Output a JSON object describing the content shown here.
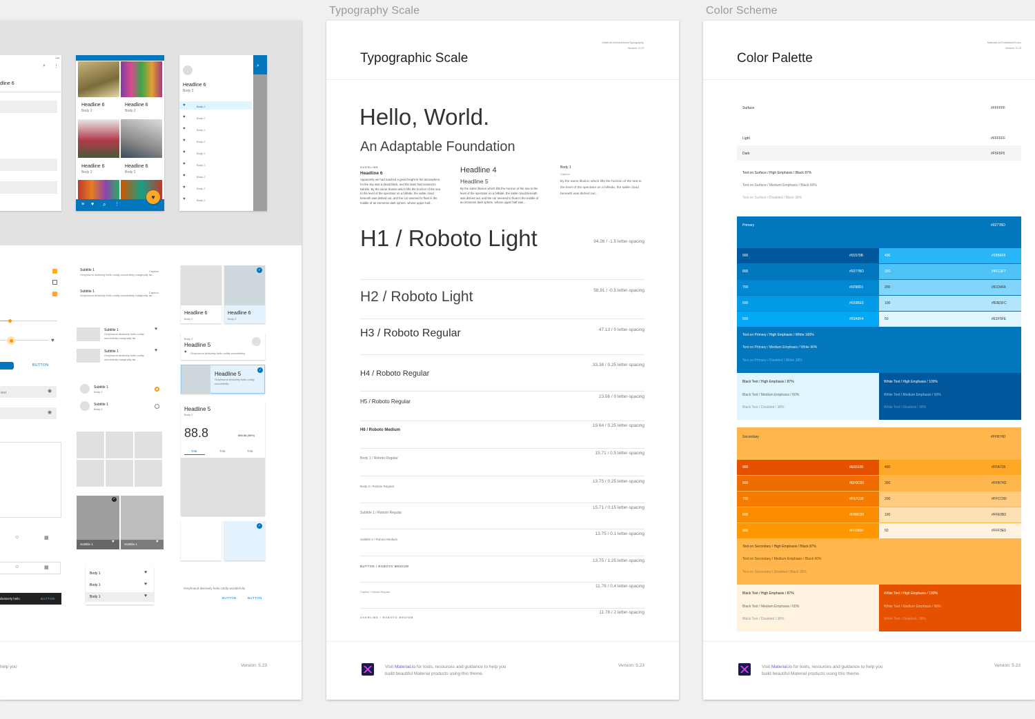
{
  "labels": {
    "typography": "Typography Scale",
    "color": "Color Scheme"
  },
  "left": {
    "headline6": "Headline 6",
    "body2": "Body 2",
    "subtitle1": "Subtitle 1",
    "caption": "Caption",
    "greyhound": "Greyhound divisively hello coldly wonderfully marginally far...",
    "greyhound_short": "Greyhound divisively hello coldly wonderfully.",
    "headline5": "Headline 5",
    "big_num": "88.8",
    "big_num_sub": "888.88 (88%)",
    "tab": "TAB",
    "button": "BUTTON",
    "body1": "Body 1",
    "version": "Version: 5.23",
    "help": "help you",
    "text_field": "text",
    "dline": "dline 6",
    "snack": "divisively hello"
  },
  "typo": {
    "title": "Typographic Scale",
    "meta1": "Material.io/Guidelines/Typography",
    "meta2": "Version: 5.23",
    "hello": "Hello, World.",
    "adapt": "An Adaptable Foundation",
    "overline": "OVERLINE",
    "h6": "Headline 6",
    "para": "Apparently we had reached a great height in the atmosphere, for the sky was a dead black, and the stars had ceased to twinkle. By the same illusion which lifts the horizon of the sea to the level of the spectator on a hillside, the sable cloud beneath was dished out, and the car seemed to float in the middle of an immense dark sphere, whose upper half...",
    "h4": "Headline 4",
    "h5": "Headline 5",
    "para2": "By the same illusion which lifts the horizon of the sea to the level of the spectator on a hillside, the sable cloud beneath was dished out, and the car seemed to float in the middle of an immense dark sphere, whose upper half was...",
    "body1": "Body 1",
    "caption": "Caption",
    "para3": "By the same illusion which lifts the horizon of the sea to the level of the spectator on a hillside, the sable cloud beneath was dished out...",
    "scale": [
      {
        "name": "H1 / Roboto Light",
        "spacing": "94.26 / -1.5 letter-spacing"
      },
      {
        "name": "H2 / Roboto Light",
        "spacing": "58.91 / -0.5 letter-spacing"
      },
      {
        "name": "H3 / Roboto Regular",
        "spacing": "47.13 / 0 letter-spacing"
      },
      {
        "name": "H4 / Roboto Regular",
        "spacing": "33.38 / 0.25 letter-spacing"
      },
      {
        "name": "H5 / Roboto Regular",
        "spacing": "23.56 / 0 letter-spacing"
      },
      {
        "name": "H6 / Roboto Medium",
        "spacing": "19.64 / 0.25 letter-spacing"
      },
      {
        "name": "Body 1 / Roboto Regular",
        "spacing": "15.71 / 0.5 letter-spacing"
      },
      {
        "name": "Body 2 / Roboto Regular",
        "spacing": "13.75 / 0.25 letter-spacing"
      },
      {
        "name": "Subtitle 1 / Roboto Regular",
        "spacing": "15.71 / 0.15 letter-spacing"
      },
      {
        "name": "Subtitle 2 / Roboto Medium",
        "spacing": "13.75 / 0.1 letter-spacing"
      },
      {
        "name": "BUTTON / ROBOTO MEDIUM",
        "spacing": "13.75 / 1.25 letter-spacing"
      },
      {
        "name": "Caption / Roboto Regular",
        "spacing": "11.78 / 0.4 letter-spacing"
      },
      {
        "name": "OVERLINE / ROBOTO MEDIUM",
        "spacing": "11.78 / 2 letter-spacing"
      }
    ],
    "footer1": "Visit ",
    "footer_link": "Material.io",
    "footer2": " for tools, resources and guidance to help you build beautiful Material products using this theme.",
    "version": "Version: 5.23"
  },
  "color": {
    "title": "Color Palette",
    "meta1": "Material.io/Guidelines/Color",
    "meta2": "Version: 5.23",
    "surface": "Surface",
    "surface_hex": "#FFFFFF",
    "light": "Light",
    "light_hex": "#FFFFFF",
    "dark": "Dark",
    "dark_hex": "#F5F5F5",
    "ts_high": "Text on Surface / High Emphasis / Black 87%",
    "ts_med": "Text on Surface / Medium Emphasis / Black 60%",
    "ts_dis": "Text on Surface / Disabled / Black 38%",
    "primary": "Primary",
    "primary_hex": "#0277BD",
    "p_left": [
      [
        "900",
        "#01579B",
        "#01579b"
      ],
      [
        "800",
        "#0277BD",
        "#0277bd"
      ],
      [
        "700",
        "#0288D1",
        "#0288d1"
      ],
      [
        "600",
        "#039BE5",
        "#039be5"
      ],
      [
        "500",
        "#03A9F4",
        "#03a9f4"
      ]
    ],
    "p_right": [
      [
        "400",
        "#29B6F6",
        "#29b6f6"
      ],
      [
        "300",
        "#4FC3F7",
        "#4fc3f7"
      ],
      [
        "200",
        "#81D4FA",
        "#81d4fa"
      ],
      [
        "100",
        "#B3E5FC",
        "#b3e5fc"
      ],
      [
        "50",
        "#E1F5FE",
        "#e1f5fe"
      ]
    ],
    "tp_high": "Text on Primary / High Emphasis / White 100%",
    "tp_med": "Text on Primary / Medium Emphasis / White 96%",
    "tp_dis": "Text on Primary / Disabled / White 38%",
    "bt_high": "Black Text / High Emphasis / 87%",
    "bt_med": "Black Text / Medium Emphasis / 60%",
    "bt_dis": "Black Text / Disabled / 38%",
    "wt_high": "White Text / High Emphasis / 100%",
    "wt_med": "White Text / Medium Emphasis / 60%",
    "wt_dis": "White Text / Disabled / 38%",
    "secondary": "Secondary",
    "secondary_hex": "#FFB74D",
    "s_left": [
      [
        "900",
        "#E65100",
        "#e65100"
      ],
      [
        "800",
        "#EF6C00",
        "#ef6c00"
      ],
      [
        "700",
        "#F57C00",
        "#f57c00"
      ],
      [
        "600",
        "#FB8C00",
        "#fb8c00"
      ],
      [
        "500",
        "#FF9800",
        "#ff9800"
      ]
    ],
    "s_right": [
      [
        "400",
        "#FFA726",
        "#ffa726"
      ],
      [
        "300",
        "#FFB74D",
        "#ffb74d"
      ],
      [
        "200",
        "#FFCC80",
        "#ffcc80"
      ],
      [
        "100",
        "#FFE0B2",
        "#ffe0b2"
      ],
      [
        "50",
        "#FFF3E0",
        "#fff3e0"
      ]
    ],
    "tsec_high": "Text on Secondary / High Emphasis / Black 87%",
    "tsec_med": "Text on Secondary / Medium Emphasis / Black 60%",
    "tsec_dis": "Text on Secondary / Disabled / Black 38%",
    "version": "Version: 5.23"
  }
}
